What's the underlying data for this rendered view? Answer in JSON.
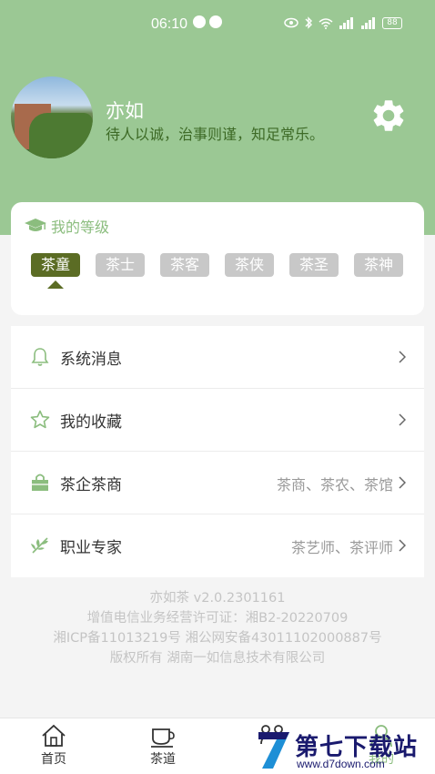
{
  "status_bar": {
    "time": "06:10",
    "battery": "88"
  },
  "profile": {
    "name": "亦如",
    "motto": "待人以诚，治事则谨，知足常乐。"
  },
  "level": {
    "title": "我的等级",
    "tags": [
      "茶童",
      "茶士",
      "茶客",
      "茶侠",
      "茶圣",
      "茶神"
    ],
    "active_index": 0
  },
  "menu": [
    {
      "label": "系统消息",
      "sub": ""
    },
    {
      "label": "我的收藏",
      "sub": ""
    },
    {
      "label": "茶企茶商",
      "sub": "茶商、茶农、茶馆"
    },
    {
      "label": "职业专家",
      "sub": "茶艺师、茶评师"
    }
  ],
  "footer": {
    "line1": "亦如茶 v2.0.2301161",
    "line2": "增值电信业务经营许可证：湘B2-20220709",
    "line3": "湘ICP备11013219号 湘公网安备43011102000887号",
    "line4": "版权所有 湖南一如信息技术有限公司"
  },
  "nav": {
    "home": "首页",
    "tea_way": "茶道",
    "mine": "我的"
  },
  "watermark": {
    "title": "第七下载站",
    "url": "www.d7down.com"
  },
  "colors": {
    "header_green": "#9bc894",
    "active_tag": "#5b6c24",
    "motto_green": "#3d6a26"
  }
}
